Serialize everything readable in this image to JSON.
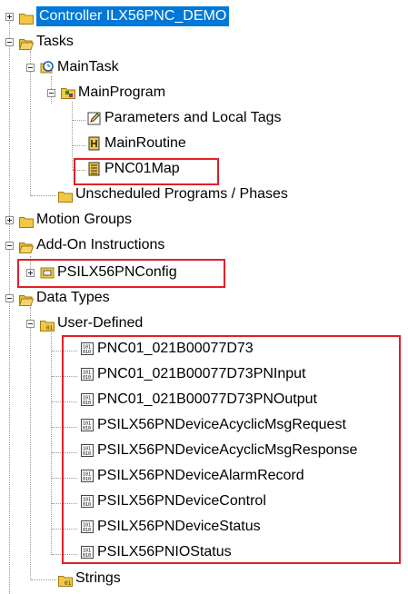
{
  "tree": {
    "controller": "Controller ILX56PNC_DEMO",
    "tasks": "Tasks",
    "main_task": "MainTask",
    "main_program": "MainProgram",
    "parameters": "Parameters and Local Tags",
    "main_routine": "MainRoutine",
    "pnc01map": "PNC01Map",
    "unscheduled": "Unscheduled Programs / Phases",
    "motion_groups": "Motion Groups",
    "addon": "Add-On Instructions",
    "psilx_config": "PSILX56PNConfig",
    "data_types": "Data Types",
    "user_defined": "User-Defined",
    "udts": [
      "PNC01_021B00077D73",
      "PNC01_021B00077D73PNInput",
      "PNC01_021B00077D73PNOutput",
      "PSILX56PNDeviceAcyclicMsgRequest",
      "PSILX56PNDeviceAcyclicMsgResponse",
      "PSILX56PNDeviceAlarmRecord",
      "PSILX56PNDeviceControl",
      "PSILX56PNDeviceStatus",
      "PSILX56PNIOStatus"
    ],
    "strings": "Strings"
  },
  "colors": {
    "selection": "#0078d7",
    "highlight_box": "#e0202a",
    "folder": "#f2c744"
  }
}
